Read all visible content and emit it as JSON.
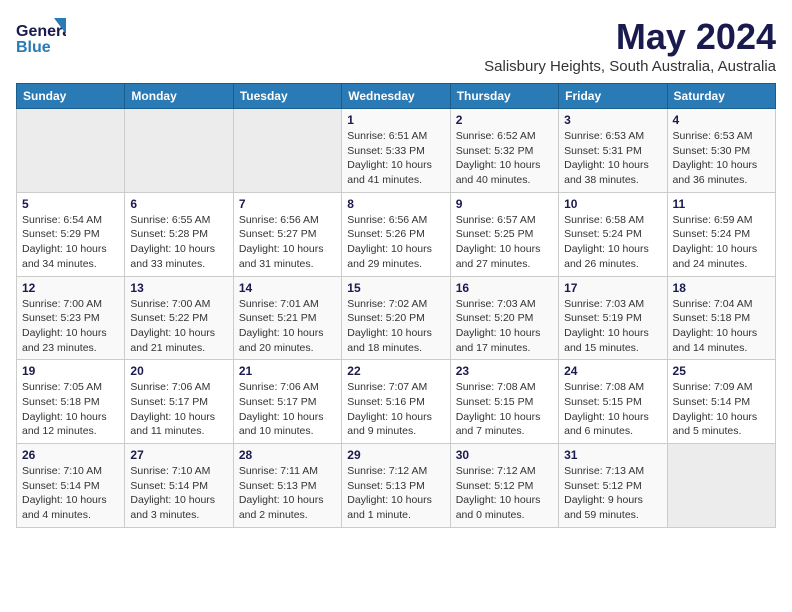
{
  "logo": {
    "text1": "General",
    "text2": "Blue"
  },
  "title": "May 2024",
  "subtitle": "Salisbury Heights, South Australia, Australia",
  "days_of_week": [
    "Sunday",
    "Monday",
    "Tuesday",
    "Wednesday",
    "Thursday",
    "Friday",
    "Saturday"
  ],
  "weeks": [
    [
      {
        "day": "",
        "empty": true
      },
      {
        "day": "",
        "empty": true
      },
      {
        "day": "",
        "empty": true
      },
      {
        "day": "1",
        "sunrise": "6:51 AM",
        "sunset": "5:33 PM",
        "daylight": "10 hours and 41 minutes."
      },
      {
        "day": "2",
        "sunrise": "6:52 AM",
        "sunset": "5:32 PM",
        "daylight": "10 hours and 40 minutes."
      },
      {
        "day": "3",
        "sunrise": "6:53 AM",
        "sunset": "5:31 PM",
        "daylight": "10 hours and 38 minutes."
      },
      {
        "day": "4",
        "sunrise": "6:53 AM",
        "sunset": "5:30 PM",
        "daylight": "10 hours and 36 minutes."
      }
    ],
    [
      {
        "day": "5",
        "sunrise": "6:54 AM",
        "sunset": "5:29 PM",
        "daylight": "10 hours and 34 minutes."
      },
      {
        "day": "6",
        "sunrise": "6:55 AM",
        "sunset": "5:28 PM",
        "daylight": "10 hours and 33 minutes."
      },
      {
        "day": "7",
        "sunrise": "6:56 AM",
        "sunset": "5:27 PM",
        "daylight": "10 hours and 31 minutes."
      },
      {
        "day": "8",
        "sunrise": "6:56 AM",
        "sunset": "5:26 PM",
        "daylight": "10 hours and 29 minutes."
      },
      {
        "day": "9",
        "sunrise": "6:57 AM",
        "sunset": "5:25 PM",
        "daylight": "10 hours and 27 minutes."
      },
      {
        "day": "10",
        "sunrise": "6:58 AM",
        "sunset": "5:24 PM",
        "daylight": "10 hours and 26 minutes."
      },
      {
        "day": "11",
        "sunrise": "6:59 AM",
        "sunset": "5:24 PM",
        "daylight": "10 hours and 24 minutes."
      }
    ],
    [
      {
        "day": "12",
        "sunrise": "7:00 AM",
        "sunset": "5:23 PM",
        "daylight": "10 hours and 23 minutes."
      },
      {
        "day": "13",
        "sunrise": "7:00 AM",
        "sunset": "5:22 PM",
        "daylight": "10 hours and 21 minutes."
      },
      {
        "day": "14",
        "sunrise": "7:01 AM",
        "sunset": "5:21 PM",
        "daylight": "10 hours and 20 minutes."
      },
      {
        "day": "15",
        "sunrise": "7:02 AM",
        "sunset": "5:20 PM",
        "daylight": "10 hours and 18 minutes."
      },
      {
        "day": "16",
        "sunrise": "7:03 AM",
        "sunset": "5:20 PM",
        "daylight": "10 hours and 17 minutes."
      },
      {
        "day": "17",
        "sunrise": "7:03 AM",
        "sunset": "5:19 PM",
        "daylight": "10 hours and 15 minutes."
      },
      {
        "day": "18",
        "sunrise": "7:04 AM",
        "sunset": "5:18 PM",
        "daylight": "10 hours and 14 minutes."
      }
    ],
    [
      {
        "day": "19",
        "sunrise": "7:05 AM",
        "sunset": "5:18 PM",
        "daylight": "10 hours and 12 minutes."
      },
      {
        "day": "20",
        "sunrise": "7:06 AM",
        "sunset": "5:17 PM",
        "daylight": "10 hours and 11 minutes."
      },
      {
        "day": "21",
        "sunrise": "7:06 AM",
        "sunset": "5:17 PM",
        "daylight": "10 hours and 10 minutes."
      },
      {
        "day": "22",
        "sunrise": "7:07 AM",
        "sunset": "5:16 PM",
        "daylight": "10 hours and 9 minutes."
      },
      {
        "day": "23",
        "sunrise": "7:08 AM",
        "sunset": "5:15 PM",
        "daylight": "10 hours and 7 minutes."
      },
      {
        "day": "24",
        "sunrise": "7:08 AM",
        "sunset": "5:15 PM",
        "daylight": "10 hours and 6 minutes."
      },
      {
        "day": "25",
        "sunrise": "7:09 AM",
        "sunset": "5:14 PM",
        "daylight": "10 hours and 5 minutes."
      }
    ],
    [
      {
        "day": "26",
        "sunrise": "7:10 AM",
        "sunset": "5:14 PM",
        "daylight": "10 hours and 4 minutes."
      },
      {
        "day": "27",
        "sunrise": "7:10 AM",
        "sunset": "5:14 PM",
        "daylight": "10 hours and 3 minutes."
      },
      {
        "day": "28",
        "sunrise": "7:11 AM",
        "sunset": "5:13 PM",
        "daylight": "10 hours and 2 minutes."
      },
      {
        "day": "29",
        "sunrise": "7:12 AM",
        "sunset": "5:13 PM",
        "daylight": "10 hours and 1 minute."
      },
      {
        "day": "30",
        "sunrise": "7:12 AM",
        "sunset": "5:12 PM",
        "daylight": "10 hours and 0 minutes."
      },
      {
        "day": "31",
        "sunrise": "7:13 AM",
        "sunset": "5:12 PM",
        "daylight": "9 hours and 59 minutes."
      },
      {
        "day": "",
        "empty": true
      }
    ]
  ]
}
